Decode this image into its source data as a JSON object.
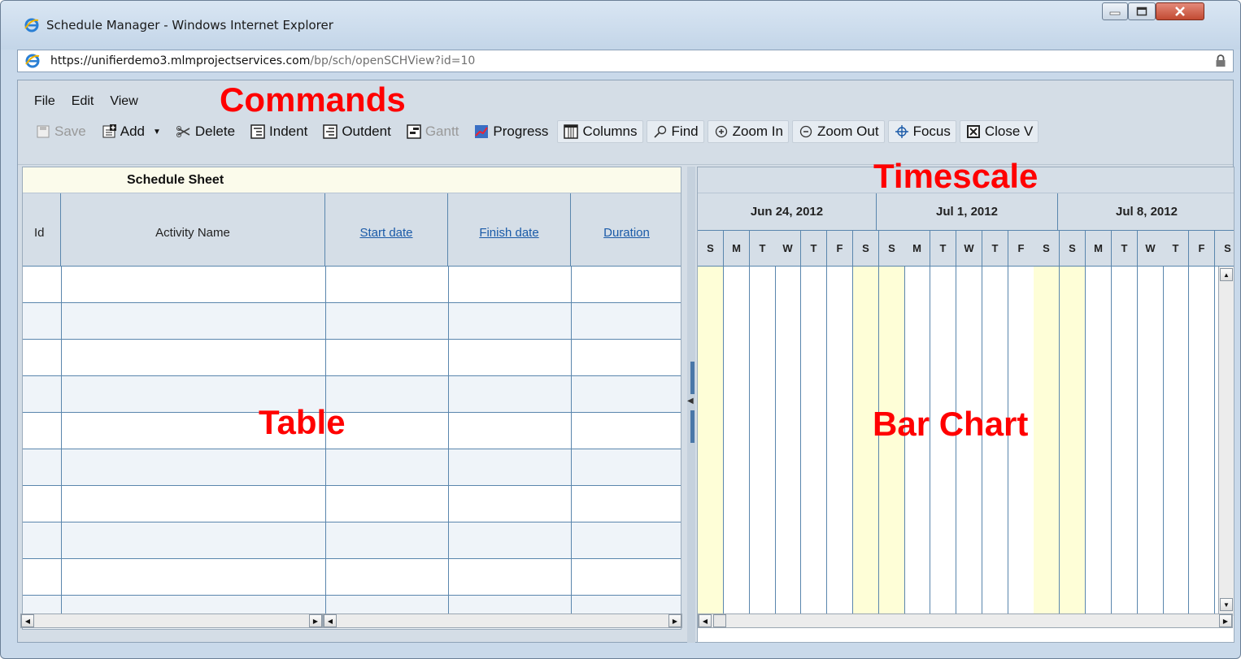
{
  "window": {
    "title": "Schedule Manager - Windows Internet Explorer",
    "url_prefix": "https://unifierdemo3.",
    "url_domain": "mlmprojectservices.com",
    "url_path": "/bp/sch/openSCHView?id=10"
  },
  "menu": [
    "File",
    "Edit",
    "View"
  ],
  "toolbar": {
    "save": "Save",
    "add": "Add",
    "delete": "Delete",
    "indent": "Indent",
    "outdent": "Outdent",
    "gantt": "Gantt",
    "progress": "Progress",
    "columns": "Columns",
    "find": "Find",
    "zoom_in": "Zoom In",
    "zoom_out": "Zoom Out",
    "focus": "Focus",
    "close_view": "Close V"
  },
  "annotations": {
    "commands": "Commands",
    "timescale": "Timescale",
    "table": "Table",
    "bar_chart": "Bar Chart"
  },
  "sheet": {
    "title": "Schedule Sheet",
    "columns": [
      "Id",
      "Activity Name",
      "Start date",
      "Finish date",
      "Duration"
    ]
  },
  "timescale": {
    "weeks": [
      "Jun 24, 2012",
      "Jul 1, 2012",
      "Jul 8, 2012"
    ],
    "days": [
      "S",
      "M",
      "T",
      "W",
      "T",
      "F",
      "S",
      "S",
      "M",
      "T",
      "W",
      "T",
      "F",
      "S",
      "S",
      "M",
      "T",
      "W",
      "T",
      "F",
      "S"
    ]
  },
  "colors": {
    "annotation": "#ff0000",
    "weekend": "#fefed7",
    "grid": "#5a86ad",
    "link": "#1a5aa8"
  }
}
